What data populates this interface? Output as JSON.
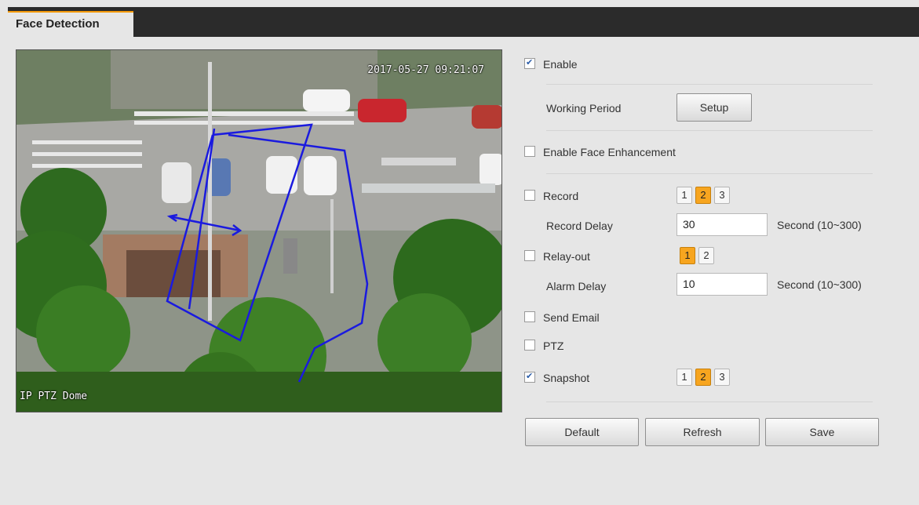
{
  "tab": {
    "title": "Face Detection"
  },
  "video": {
    "timestamp": "2017-05-27 09:21:07",
    "camera_name": "IP PTZ Dome"
  },
  "enable": {
    "label": "Enable",
    "checked": true
  },
  "working_period": {
    "label": "Working Period",
    "button": "Setup"
  },
  "face_enhancement": {
    "label": "Enable Face Enhancement",
    "checked": false
  },
  "record": {
    "label": "Record",
    "checked": false,
    "channels": [
      "1",
      "2",
      "3"
    ],
    "selected": "2"
  },
  "record_delay": {
    "label": "Record Delay",
    "value": "30",
    "unit": "Second (10~300)"
  },
  "relay_out": {
    "label": "Relay-out",
    "checked": false,
    "channels": [
      "1",
      "2"
    ],
    "selected": "1"
  },
  "alarm_delay": {
    "label": "Alarm Delay",
    "value": "10",
    "unit": "Second (10~300)"
  },
  "send_email": {
    "label": "Send Email",
    "checked": false
  },
  "ptz": {
    "label": "PTZ",
    "checked": false
  },
  "snapshot": {
    "label": "Snapshot",
    "checked": true,
    "channels": [
      "1",
      "2",
      "3"
    ],
    "selected": "2"
  },
  "actions": {
    "default": "Default",
    "refresh": "Refresh",
    "save": "Save"
  },
  "colors": {
    "accent": "#f7a51f",
    "topbar": "#2b2b2b",
    "rule_line": "#1a1adf"
  }
}
